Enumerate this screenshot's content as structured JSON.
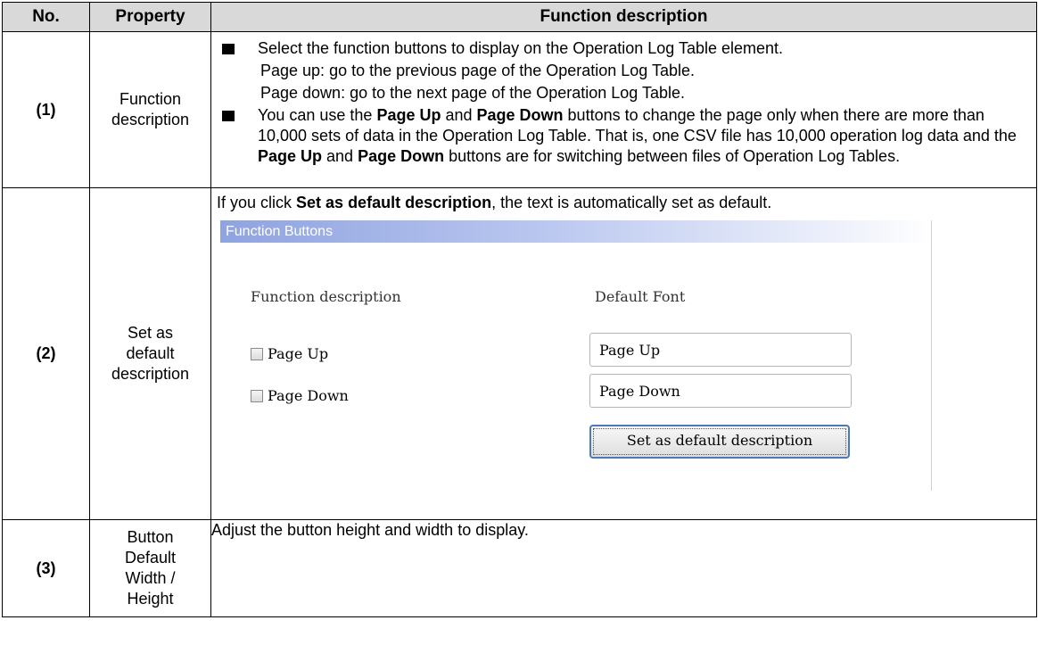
{
  "headers": {
    "no": "No.",
    "property": "Property",
    "function_description": "Function description"
  },
  "rows": [
    {
      "no": "(1)",
      "property": "Function description",
      "bullet1": "Select the function buttons to display on the Operation Log Table element.",
      "sub1": "Page up: go to the previous page of the Operation Log Table.",
      "sub2": "Page down: go to the next page of the Operation Log Table.",
      "bullet2": {
        "t1": "You can use the ",
        "b1": "Page Up",
        "t2": " and ",
        "b2": "Page Down",
        "t3": " buttons to change the page only when there are more than 10,000 sets of data in the Operation Log Table. That is, one CSV file has 10,000 operation log data and the ",
        "b3": "Page Up",
        "t4": " and ",
        "b4": "Page Down",
        "t5": " buttons are for switching between files of Operation Log Tables."
      }
    },
    {
      "no": "(2)",
      "property_lines": [
        "Set as",
        "default",
        "description"
      ],
      "intro": {
        "t1": "If you click ",
        "b1": "Set as default description",
        "t2": ", the text is automatically set as default."
      },
      "dialog": {
        "title": "Function Buttons",
        "col_left": "Function description",
        "col_right": "Default Font",
        "checkbox1": "Page Up",
        "checkbox2": "Page Down",
        "field1": "Page Up",
        "field2": "Page Down",
        "button": "Set as default description"
      }
    },
    {
      "no": "(3)",
      "property_lines": [
        "Button",
        "Default",
        "Width /",
        "Height"
      ],
      "description": "Adjust the button height and width to display."
    }
  ]
}
